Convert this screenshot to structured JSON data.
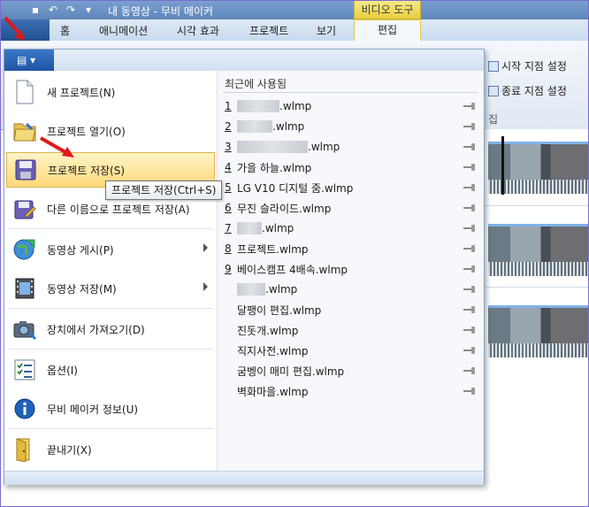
{
  "window": {
    "title": "내 동영상 - 무비 메이커",
    "contextual_tab_group": "비디오 도구"
  },
  "ribbon": {
    "tabs": [
      "홈",
      "애니메이션",
      "시각 효과",
      "프로젝트",
      "보기",
      "편집"
    ],
    "commands": {
      "set_start": "시작 지점 설정",
      "set_end": "종료 지점 설정",
      "group_partial": "집"
    }
  },
  "menu": {
    "items": [
      {
        "label": "새 프로젝트(N)",
        "icon": "new-document-icon"
      },
      {
        "label": "프로젝트 열기(O)",
        "icon": "open-folder-icon"
      },
      {
        "label": "프로젝트 저장(S)",
        "icon": "save-disk-icon"
      },
      {
        "label": "다른 이름으로 프로젝트 저장(A)",
        "icon": "save-as-icon"
      },
      {
        "label": "동영상 게시(P)",
        "icon": "globe-publish-icon"
      },
      {
        "label": "동영상 저장(M)",
        "icon": "film-save-icon"
      },
      {
        "label": "장치에서 가져오기(D)",
        "icon": "camera-import-icon"
      },
      {
        "label": "옵션(I)",
        "icon": "options-list-icon"
      },
      {
        "label": "무비 메이커 정보(U)",
        "icon": "info-icon"
      },
      {
        "label": "끝내기(X)",
        "icon": "exit-door-icon"
      }
    ],
    "tooltip": "프로젝트 저장(Ctrl+S)",
    "recent_title": "최근에 사용됨",
    "recent": [
      {
        "num": "1",
        "name": ".wlmp",
        "redacted": true
      },
      {
        "num": "2",
        "name": ".wlmp",
        "redacted": true
      },
      {
        "num": "3",
        "name": ".wlmp",
        "redacted": true
      },
      {
        "num": "4",
        "name": "가을 하늘.wlmp",
        "redacted": false
      },
      {
        "num": "5",
        "name": "LG V10 디지털 줌.wlmp",
        "redacted": false
      },
      {
        "num": "6",
        "name": "무진 슬라이드.wlmp",
        "redacted": false
      },
      {
        "num": "7",
        "name": ".wlmp",
        "redacted": true
      },
      {
        "num": "8",
        "name": "프로젝트.wlmp",
        "redacted": false
      },
      {
        "num": "9",
        "name": "베이스캠프 4배속.wlmp",
        "redacted": false
      },
      {
        "num": "",
        "name": ".wlmp",
        "redacted": true
      },
      {
        "num": "",
        "name": "달팽이 편집.wlmp",
        "redacted": false
      },
      {
        "num": "",
        "name": "진돗개.wlmp",
        "redacted": false
      },
      {
        "num": "",
        "name": "직지사전.wlmp",
        "redacted": false
      },
      {
        "num": "",
        "name": "굼벵이 매미 편집.wlmp",
        "redacted": false
      },
      {
        "num": "",
        "name": "벽화마을.wlmp",
        "redacted": false
      }
    ]
  }
}
